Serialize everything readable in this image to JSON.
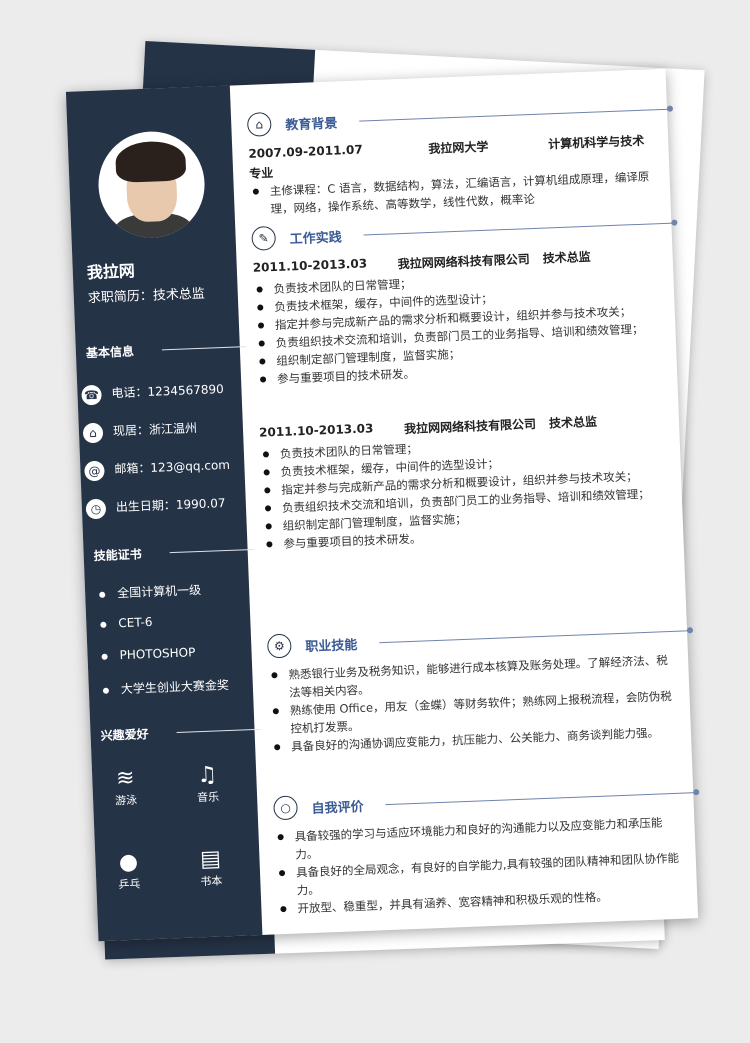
{
  "sidebar": {
    "name": "我拉网",
    "job": "求职简历：技术总监",
    "basic_title": "基本信息",
    "contacts": [
      {
        "icon": "phone-icon",
        "glyph": "☎",
        "text": "电话：1234567890"
      },
      {
        "icon": "home-icon",
        "glyph": "⌂",
        "text": "现居：浙江温州"
      },
      {
        "icon": "email-icon",
        "glyph": "@",
        "text": "邮箱：123@qq.com"
      },
      {
        "icon": "clock-icon",
        "glyph": "◷",
        "text": "出生日期：1990.07"
      }
    ],
    "cert_title": "技能证书",
    "certs": [
      "全国计算机一级",
      "CET-6",
      "PHOTOSHOP",
      "大学生创业大赛金奖"
    ],
    "hobby_title": "兴趣爱好",
    "hobbies": [
      {
        "icon": "swim-icon",
        "glyph": "≋",
        "label": "游泳"
      },
      {
        "icon": "music-icon",
        "glyph": "♫",
        "label": "音乐"
      },
      {
        "icon": "pingpong-icon",
        "glyph": "●",
        "label": "乒乓"
      },
      {
        "icon": "book-icon",
        "glyph": "▤",
        "label": "书本"
      }
    ]
  },
  "education": {
    "title": "教育背景",
    "date": "2007.09-2011.07",
    "school": "我拉网大学",
    "major": "计算机科学与技术",
    "major_suffix": "专业",
    "bullets": [
      "主修课程：C 语言，数据结构，算法，汇编语言，计算机组成原理，编译原理，网络，操作系统、高等数学，线性代数，概率论"
    ]
  },
  "work": {
    "title": "工作实践",
    "jobs": [
      {
        "date": "2011.10-2013.03",
        "company": "我拉网网络科技有限公司",
        "position": "技术总监",
        "bullets": [
          "负责技术团队的日常管理；",
          "负责技术框架，缓存，中间件的选型设计；",
          "指定并参与完成新产品的需求分析和概要设计，组织并参与技术攻关；",
          "负责组织技术交流和培训，负责部门员工的业务指导、培训和绩效管理；",
          "组织制定部门管理制度，监督实施；",
          "参与重要项目的技术研发。"
        ]
      },
      {
        "date": "2011.10-2013.03",
        "company": "我拉网网络科技有限公司",
        "position": "技术总监",
        "bullets": [
          "负责技术团队的日常管理；",
          "负责技术框架，缓存，中间件的选型设计；",
          "指定并参与完成新产品的需求分析和概要设计，组织并参与技术攻关；",
          "负责组织技术交流和培训，负责部门员工的业务指导、培训和绩效管理；",
          "组织制定部门管理制度，监督实施；",
          "参与重要项目的技术研发。"
        ]
      }
    ]
  },
  "skills": {
    "title": "职业技能",
    "bullets": [
      "熟悉银行业务及税务知识，能够进行成本核算及账务处理。了解经济法、税法等相关内容。",
      "熟练使用 Office，用友（金蝶）等财务软件；熟练网上报税流程，会防伪税控机打发票。",
      "具备良好的沟通协调应变能力，抗压能力、公关能力、商务谈判能力强。"
    ]
  },
  "self": {
    "title": "自我评价",
    "bullets": [
      "具备较强的学习与适应环境能力和良好的沟通能力以及应变能力和承压能力。",
      "具备良好的全局观念，有良好的自学能力,具有较强的团队精神和团队协作能力。",
      "开放型、稳重型，并具有涵养、宽容精神和积极乐观的性格。"
    ]
  },
  "colors": {
    "navy": "#253347",
    "accent": "#3a5b94"
  }
}
